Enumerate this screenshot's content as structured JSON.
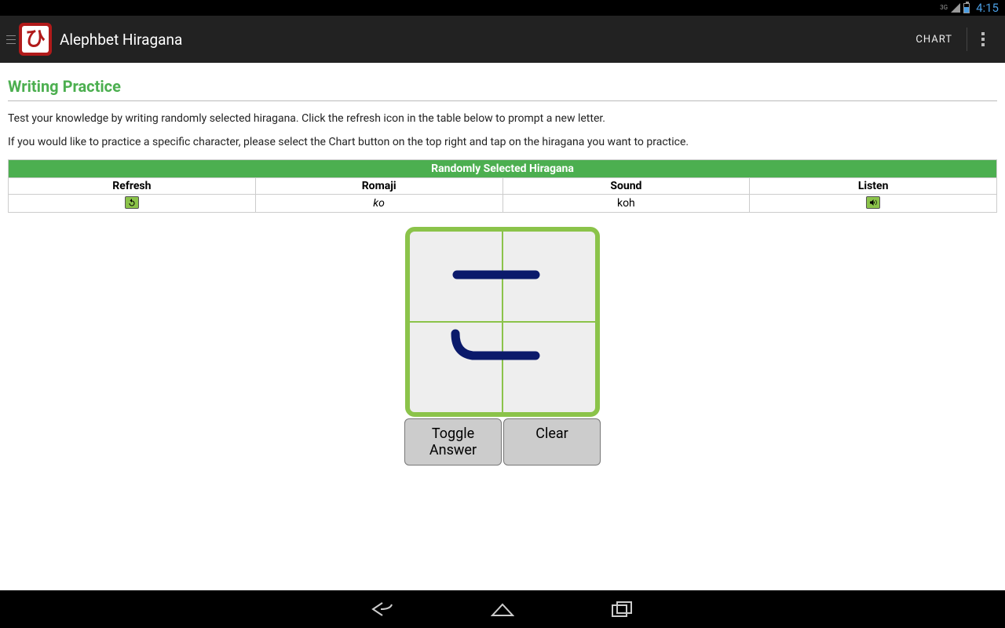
{
  "statusbar": {
    "network": "3G",
    "time": "4:15"
  },
  "actionbar": {
    "title": "Alephbet Hiragana",
    "chart_label": "CHART",
    "logo_glyph": "ひ"
  },
  "page": {
    "heading": "Writing Practice",
    "instruction1": "Test your knowledge by writing randomly selected hiragana.  Click the refresh icon in the table below to prompt a new letter.",
    "instruction2": "If you would like to practice a specific character, please select the Chart button on the top right and tap on the hiragana you want to practice."
  },
  "table": {
    "title": "Randomly Selected Hiragana",
    "headers": {
      "refresh": "Refresh",
      "romaji": "Romaji",
      "sound": "Sound",
      "listen": "Listen"
    },
    "row": {
      "romaji": "ko",
      "sound": "koh"
    }
  },
  "buttons": {
    "toggle": "Toggle Answer",
    "clear": "Clear"
  }
}
